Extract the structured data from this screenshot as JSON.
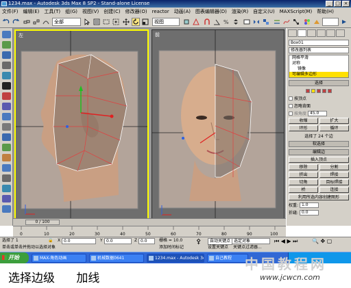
{
  "window": {
    "title": "1234.max - Autodesk 3ds Max 8 SP2 - Stand-alone License",
    "buttons": [
      "_",
      "□",
      "×"
    ]
  },
  "menu": [
    "文件(F)",
    "编辑(E)",
    "工具(T)",
    "组(G)",
    "视图(V)",
    "创建(C)",
    "修改器(O)",
    "reactor",
    "动画(A)",
    "图表编辑器(D)",
    "渲染(R)",
    "自定义(U)",
    "MAXScript(M)",
    "帮助(H)"
  ],
  "toolbar": {
    "selection_filter": "全部",
    "reference_coord": "视图"
  },
  "viewports": {
    "left_label": "左",
    "right_label": "前"
  },
  "command_panel": {
    "object_name": "Box01",
    "modifier_list": "修改器列表",
    "stack": [
      "网格平滑",
      "对称",
      "镜像",
      "可编辑多边形"
    ],
    "selection_rollout": "选择",
    "by_vertex": "按顶点",
    "ignore_backfacing": "忽略背面",
    "by_angle": "按角度",
    "angle_value": "45.0",
    "shrink": "收缩",
    "grow": "扩大",
    "ring": "环形",
    "loop": "循环",
    "selected_info": "选择了 24 个边",
    "soft_selection": "软选择",
    "edit_edges": "编辑边",
    "insert_vertex": "插入顶点",
    "remove": "移除",
    "split": "分割",
    "extrude": "挤出",
    "weld": "焊接",
    "chamfer": "切角",
    "target_weld": "目标焊接",
    "bridge": "桥",
    "connect": "连接",
    "create_shape": "利用所选内容创建图形",
    "weight_label": "权重:",
    "weight_value": "1.0",
    "crease_label": "折缝:",
    "crease_value": "0.0"
  },
  "timeline": {
    "frame": "0 / 100",
    "ticks": [
      "0",
      "10",
      "20",
      "30",
      "40",
      "50",
      "60",
      "70",
      "80",
      "90",
      "100"
    ]
  },
  "status": {
    "selected": "选择了 1",
    "x_label": "X",
    "x_value": "0.0",
    "y_label": "Y",
    "y_value": "0.0",
    "z_label": "Z",
    "z_value": "0.0",
    "grid": "栅格 = 10.0",
    "auto_key": "自动关键点",
    "selected_obj": "选定对象",
    "set_key": "设置关键点",
    "key_filters": "关键点过滤器...",
    "prompt": "单击或单击并拖动以选择对象",
    "add_time_tag": "添加时间标记"
  },
  "taskbar": {
    "start": "开始",
    "tasks": [
      "MAX-角色动画",
      "机械数据0641",
      "1234.max - Autodesk 3ds Max",
      "自己教程"
    ]
  },
  "caption": {
    "left": "选择边级",
    "right": "加线"
  },
  "watermark": {
    "text": "中国教程网",
    "url": "www.jcwcn.com"
  }
}
